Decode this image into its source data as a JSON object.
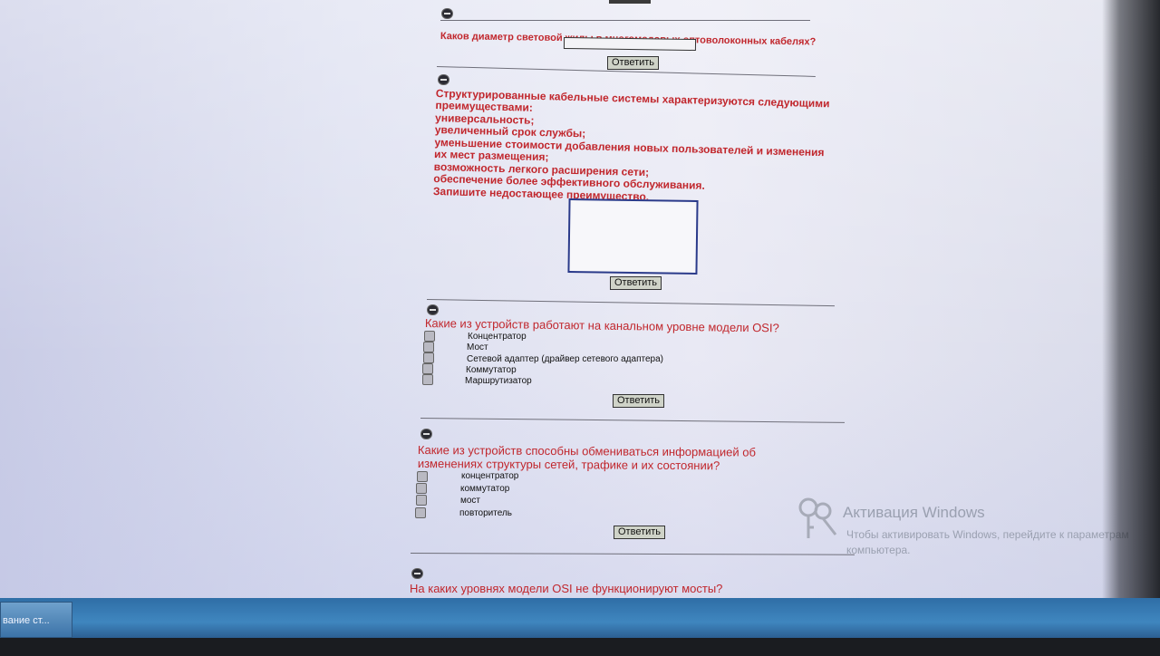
{
  "questions": [
    {
      "text": "Каков диаметр световой жилы в многомодовых оптоволоконных кабелях?",
      "type": "text-input",
      "submit": "Ответить"
    },
    {
      "lines": [
        "Структурированные кабельные системы характеризуются следующими",
        "преимуществами:",
        "универсальность;",
        "увеличенный срок службы;",
        "уменьшение стоимости добавления новых пользователей и изменения",
        "их мест размещения;",
        "возможность легкого расширения сети;",
        "обеспечение более эффективного обслуживания.",
        "Запишите недостающее преимущество."
      ],
      "type": "textarea",
      "submit": "Ответить"
    },
    {
      "text": "Какие из устройств работают на канальном уровне модели OSI?",
      "type": "checkbox",
      "options": [
        "Концентратор",
        "Мост",
        "Сетевой адаптер (драйвер сетевого адаптера)",
        "Коммутатор",
        "Маршрутизатор"
      ],
      "submit": "Ответить"
    },
    {
      "lines": [
        "Какие из устройств способны обмениваться информацией об",
        "изменениях структуры сетей, трафике и их состоянии?"
      ],
      "type": "checkbox",
      "options": [
        "концентратор",
        "коммутатор",
        "мост",
        "повторитель"
      ],
      "submit": "Ответить"
    },
    {
      "text": "На каких уровнях модели OSI не функционируют мосты?",
      "type": "partial"
    }
  ],
  "watermark": {
    "title": "Активация Windows",
    "subtitle": "Чтобы активировать Windows, перейдите к параметрам компьютера.",
    "icon": "key-icon"
  },
  "taskbar": {
    "item_label": "вание ст..."
  },
  "colors": {
    "question_text": "#c1272d",
    "taskbar": "#3f86bf"
  }
}
